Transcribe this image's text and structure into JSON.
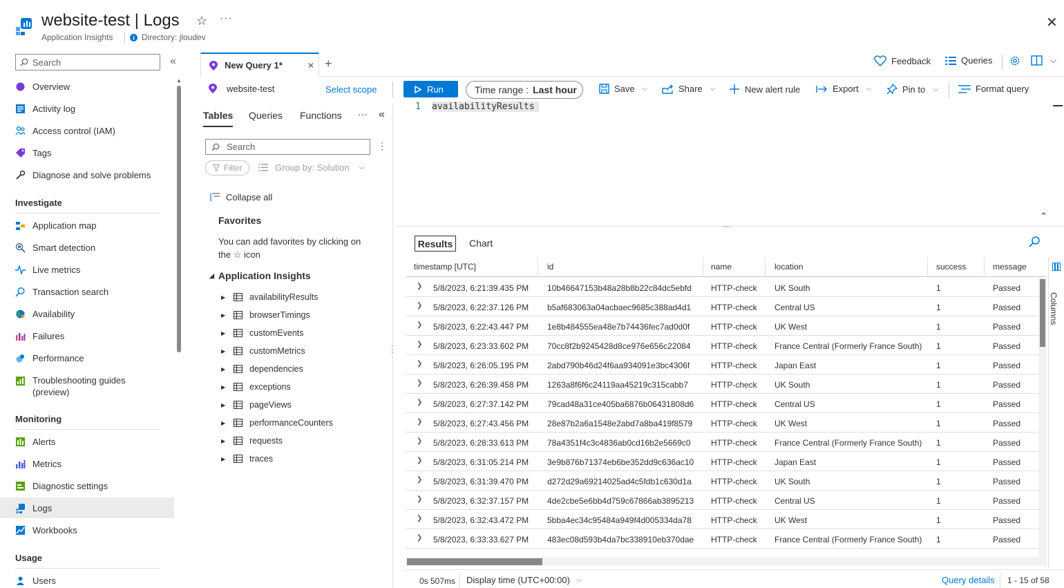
{
  "header": {
    "title": "website-test | Logs",
    "subtitle": "Application Insights",
    "directory": "Directory: jloudev"
  },
  "nav": {
    "search_placeholder": "Search",
    "items_top": [
      "Overview",
      "Activity log",
      "Access control (IAM)",
      "Tags",
      "Diagnose and solve problems"
    ],
    "investigate_title": "Investigate",
    "investigate": [
      "Application map",
      "Smart detection",
      "Live metrics",
      "Transaction search",
      "Availability",
      "Failures",
      "Performance",
      "Troubleshooting guides",
      "(preview)"
    ],
    "monitoring_title": "Monitoring",
    "monitoring": [
      "Alerts",
      "Metrics",
      "Diagnostic settings",
      "Logs",
      "Workbooks"
    ],
    "usage_title": "Usage",
    "usage": [
      "Users"
    ],
    "active_item": "Logs"
  },
  "tabs": {
    "query_tab": "New Query 1*",
    "feedback": "Feedback",
    "queries": "Queries"
  },
  "toolbar": {
    "scope_name": "website-test",
    "select_scope": "Select scope",
    "run": "Run",
    "time_range_label": "Time range :",
    "time_range_value": "Last hour",
    "save": "Save",
    "share": "Share",
    "new_alert_rule": "New alert rule",
    "export": "Export",
    "pin_to": "Pin to",
    "format_query": "Format query"
  },
  "schema": {
    "tabs": [
      "Tables",
      "Queries",
      "Functions"
    ],
    "search_placeholder": "Search",
    "filter": "Filter",
    "group_by": "Group by: Solution",
    "collapse_all": "Collapse all",
    "favorites_title": "Favorites",
    "favorites_text_1": "You can add favorites by clicking on",
    "favorites_text_2": "the",
    "favorites_text_3": "icon",
    "group_title": "Application Insights",
    "tables": [
      "availabilityResults",
      "browserTimings",
      "customEvents",
      "customMetrics",
      "dependencies",
      "exceptions",
      "pageViews",
      "performanceCounters",
      "requests",
      "traces"
    ]
  },
  "editor": {
    "line_number": "1",
    "code": "availabilityResults"
  },
  "results": {
    "tab_results": "Results",
    "tab_chart": "Chart",
    "columns_label": "Columns",
    "columns": [
      "timestamp [UTC]",
      "id",
      "name",
      "location",
      "success",
      "message"
    ],
    "rows": [
      [
        "5/8/2023, 6:21:39.435 PM",
        "10b46647153b48a28b8b22c84dc5ebfd",
        "HTTP-check",
        "UK South",
        "1",
        "Passed"
      ],
      [
        "5/8/2023, 6:22:37.126 PM",
        "b5af683063a04acbaec9685c388ad4d1",
        "HTTP-check",
        "Central US",
        "1",
        "Passed"
      ],
      [
        "5/8/2023, 6:22:43.447 PM",
        "1e8b484555ea48e7b74436fec7ad0d0f",
        "HTTP-check",
        "UK West",
        "1",
        "Passed"
      ],
      [
        "5/8/2023, 6:23:33.602 PM",
        "70cc8f2b9245428d8ce976e656c22084",
        "HTTP-check",
        "France Central (Formerly France South)",
        "1",
        "Passed"
      ],
      [
        "5/8/2023, 6:26:05.195 PM",
        "2abd790b46d24f6aa934091e3bc4306f",
        "HTTP-check",
        "Japan East",
        "1",
        "Passed"
      ],
      [
        "5/8/2023, 6:26:39.458 PM",
        "1263a8f6f6c24119aa45219c315cabb7",
        "HTTP-check",
        "UK South",
        "1",
        "Passed"
      ],
      [
        "5/8/2023, 6:27:37.142 PM",
        "79cad48a31ce405ba6876b06431808d6",
        "HTTP-check",
        "Central US",
        "1",
        "Passed"
      ],
      [
        "5/8/2023, 6:27:43.456 PM",
        "28e87b2a6a1548e2abd7a8ba419f8579",
        "HTTP-check",
        "UK West",
        "1",
        "Passed"
      ],
      [
        "5/8/2023, 6:28:33.613 PM",
        "78a4351f4c3c4836ab0cd16b2e5669c0",
        "HTTP-check",
        "France Central (Formerly France South)",
        "1",
        "Passed"
      ],
      [
        "5/8/2023, 6:31:05.214 PM",
        "3e9b876b71374eb6be352dd9c636ac10",
        "HTTP-check",
        "Japan East",
        "1",
        "Passed"
      ],
      [
        "5/8/2023, 6:31:39.470 PM",
        "d272d29a69214025ad4c5fdb1c630d1a",
        "HTTP-check",
        "UK South",
        "1",
        "Passed"
      ],
      [
        "5/8/2023, 6:32:37.157 PM",
        "4de2cbe5e6bb4d759c67866ab3895213",
        "HTTP-check",
        "Central US",
        "1",
        "Passed"
      ],
      [
        "5/8/2023, 6:32:43.472 PM",
        "5bba4ec34c95484a949f4d005334da78",
        "HTTP-check",
        "UK West",
        "1",
        "Passed"
      ],
      [
        "5/8/2023, 6:33:33.627 PM",
        "483ec08d593b4da7bc338910eb370dae",
        "HTTP-check",
        "France Central (Formerly France South)",
        "1",
        "Passed"
      ]
    ]
  },
  "status": {
    "elapsed": "0s 507ms",
    "display_time": "Display time (UTC+00:00)",
    "query_details": "Query details",
    "count": "1 - 15 of 58"
  },
  "colors": {
    "accent": "#0078d4",
    "active_nav_bg": "#edebe9"
  }
}
